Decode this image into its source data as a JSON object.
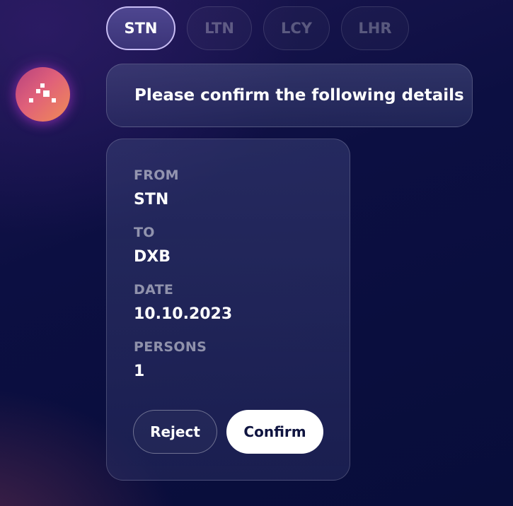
{
  "airport_chips": [
    {
      "label": "STN",
      "selected": true
    },
    {
      "label": "LTN",
      "selected": false
    },
    {
      "label": "LCY",
      "selected": false
    },
    {
      "label": "LHR",
      "selected": false
    }
  ],
  "assistant": {
    "icon": "assistant-logo-icon",
    "message": "Please confirm the following details"
  },
  "details": {
    "from_label": "FROM",
    "from_value": "STN",
    "to_label": "TO",
    "to_value": "DXB",
    "date_label": "DATE",
    "date_value": "10.10.2023",
    "persons_label": "PERSONS",
    "persons_value": "1"
  },
  "actions": {
    "reject_label": "Reject",
    "confirm_label": "Confirm"
  },
  "colors": {
    "background": "#0c0f42",
    "chip_selected": "#4e4690",
    "chip_selected_border": "#c8bdf4",
    "avatar_gradient_start": "#b7427e",
    "avatar_gradient_end": "#f08c55",
    "confirm_button": "#ffffff"
  }
}
